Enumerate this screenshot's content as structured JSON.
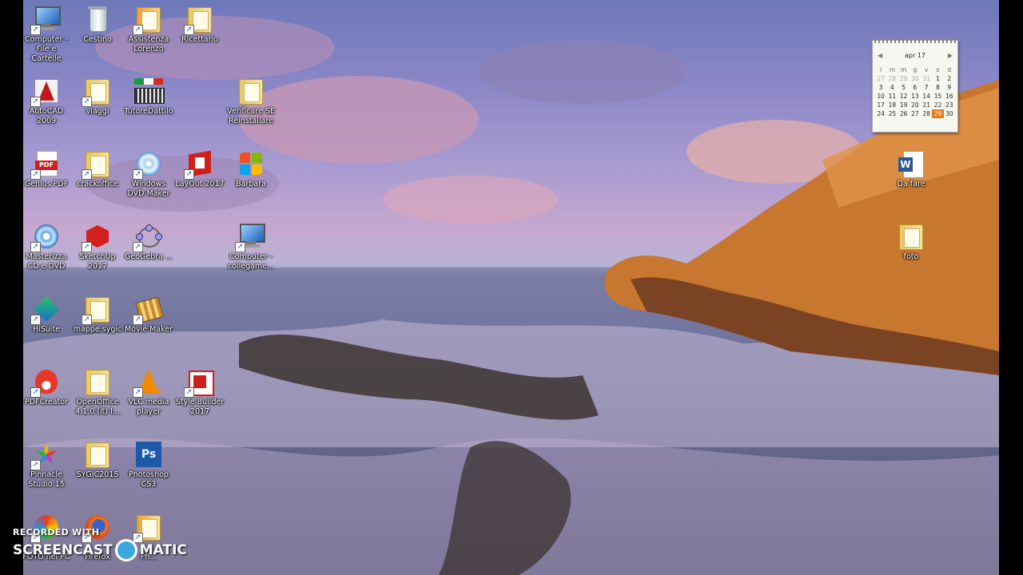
{
  "desktop_icons": [
    {
      "label": "Computer - File e Cartelle",
      "icon": "computer-icon"
    },
    {
      "label": "Cestino",
      "icon": "recycle-bin-icon"
    },
    {
      "label": "Assistenza Lorenzo",
      "icon": "folder-icon"
    },
    {
      "label": "Ricettario",
      "icon": "folder-icon"
    },
    {
      "label": "AutoCAD 2009",
      "icon": "autocad-icon"
    },
    {
      "label": "viaggi",
      "icon": "folder-icon"
    },
    {
      "label": "TutoreDattilo",
      "icon": "keyboard-icon"
    },
    {
      "label": "Verificare SE Reinstallare",
      "icon": "folder-icon"
    },
    {
      "label": "Genius PDF",
      "icon": "pdf-icon"
    },
    {
      "label": "crackoffice",
      "icon": "folder-icon"
    },
    {
      "label": "Windows DVD Maker",
      "icon": "dvd-maker-icon"
    },
    {
      "label": "LayOut 2017",
      "icon": "layout-icon"
    },
    {
      "label": "Barbara",
      "icon": "windows-logo-icon"
    },
    {
      "label": "Masterizza CD e DVD",
      "icon": "disc-icon"
    },
    {
      "label": "SketchUp 2017",
      "icon": "sketchup-icon"
    },
    {
      "label": "GeoGebra ...",
      "icon": "geogebra-icon"
    },
    {
      "label": "Computer - collegame...",
      "icon": "computer-icon"
    },
    {
      "label": "HiSuite",
      "icon": "hisuite-icon"
    },
    {
      "label": "mappe sygic",
      "icon": "folder-icon"
    },
    {
      "label": "Movie Maker",
      "icon": "movie-maker-icon"
    },
    {
      "label": "PDFCreator",
      "icon": "pdfcreator-icon"
    },
    {
      "label": "OpenOffice 4.1.0 (it) I...",
      "icon": "folder-icon"
    },
    {
      "label": "VLC media player",
      "icon": "vlc-icon"
    },
    {
      "label": "Style Builder 2017",
      "icon": "style-builder-icon"
    },
    {
      "label": "Pinnacle Studio 15",
      "icon": "pinnacle-icon"
    },
    {
      "label": "SYGIC2015",
      "icon": "folder-icon"
    },
    {
      "label": "Photoshop CS3",
      "icon": "photoshop-icon"
    },
    {
      "label": "FOTO nel PC",
      "icon": "photos-icon"
    },
    {
      "label": "Firefox",
      "icon": "firefox-icon"
    },
    {
      "label": "Ph...",
      "icon": "folder-icon"
    },
    {
      "label": "Da fare",
      "icon": "word-document-icon"
    },
    {
      "label": "foto",
      "icon": "folder-icon"
    }
  ],
  "calendar": {
    "month_label": "apr 17",
    "prev": "◀",
    "next": "▶",
    "weekday_headers": [
      "l",
      "m",
      "m",
      "g",
      "v",
      "s",
      "d"
    ],
    "weeks": [
      [
        "27",
        "28",
        "29",
        "30",
        "31",
        "1",
        "2"
      ],
      [
        "3",
        "4",
        "5",
        "6",
        "7",
        "8",
        "9"
      ],
      [
        "10",
        "11",
        "12",
        "13",
        "14",
        "15",
        "16"
      ],
      [
        "17",
        "18",
        "19",
        "20",
        "21",
        "22",
        "23"
      ],
      [
        "24",
        "25",
        "26",
        "27",
        "28",
        "29",
        "30"
      ]
    ],
    "today": "29",
    "accent": "#e27a22"
  },
  "watermark": {
    "line1": "RECORDED WITH",
    "line2_a": "SCREENCAST",
    "line2_b": "MATIC"
  }
}
